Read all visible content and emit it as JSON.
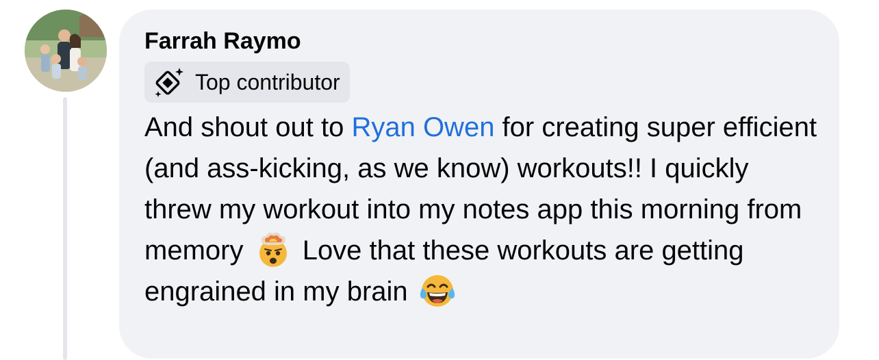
{
  "comment": {
    "author": "Farrah Raymo",
    "badge": {
      "label": "Top contributor",
      "icon": "top-contributor-icon"
    },
    "text": {
      "before_mention": "And shout out to ",
      "mention": "Ryan Owen",
      "after_mention": " for creating super efficient (and ass-kicking, as we know) workouts!! I quickly threw my workout into my notes app this morning from memory ",
      "emoji_1": "exploding-head-emoji",
      "middle": " Love that these workouts are getting engrained in my brain ",
      "emoji_2": "tears-of-joy-emoji"
    }
  },
  "colors": {
    "bubble_background": "#f0f2f5",
    "badge_background": "#e4e6eb",
    "mention": "#216fdb",
    "text": "#050505",
    "thread_line": "#e4e6eb"
  }
}
